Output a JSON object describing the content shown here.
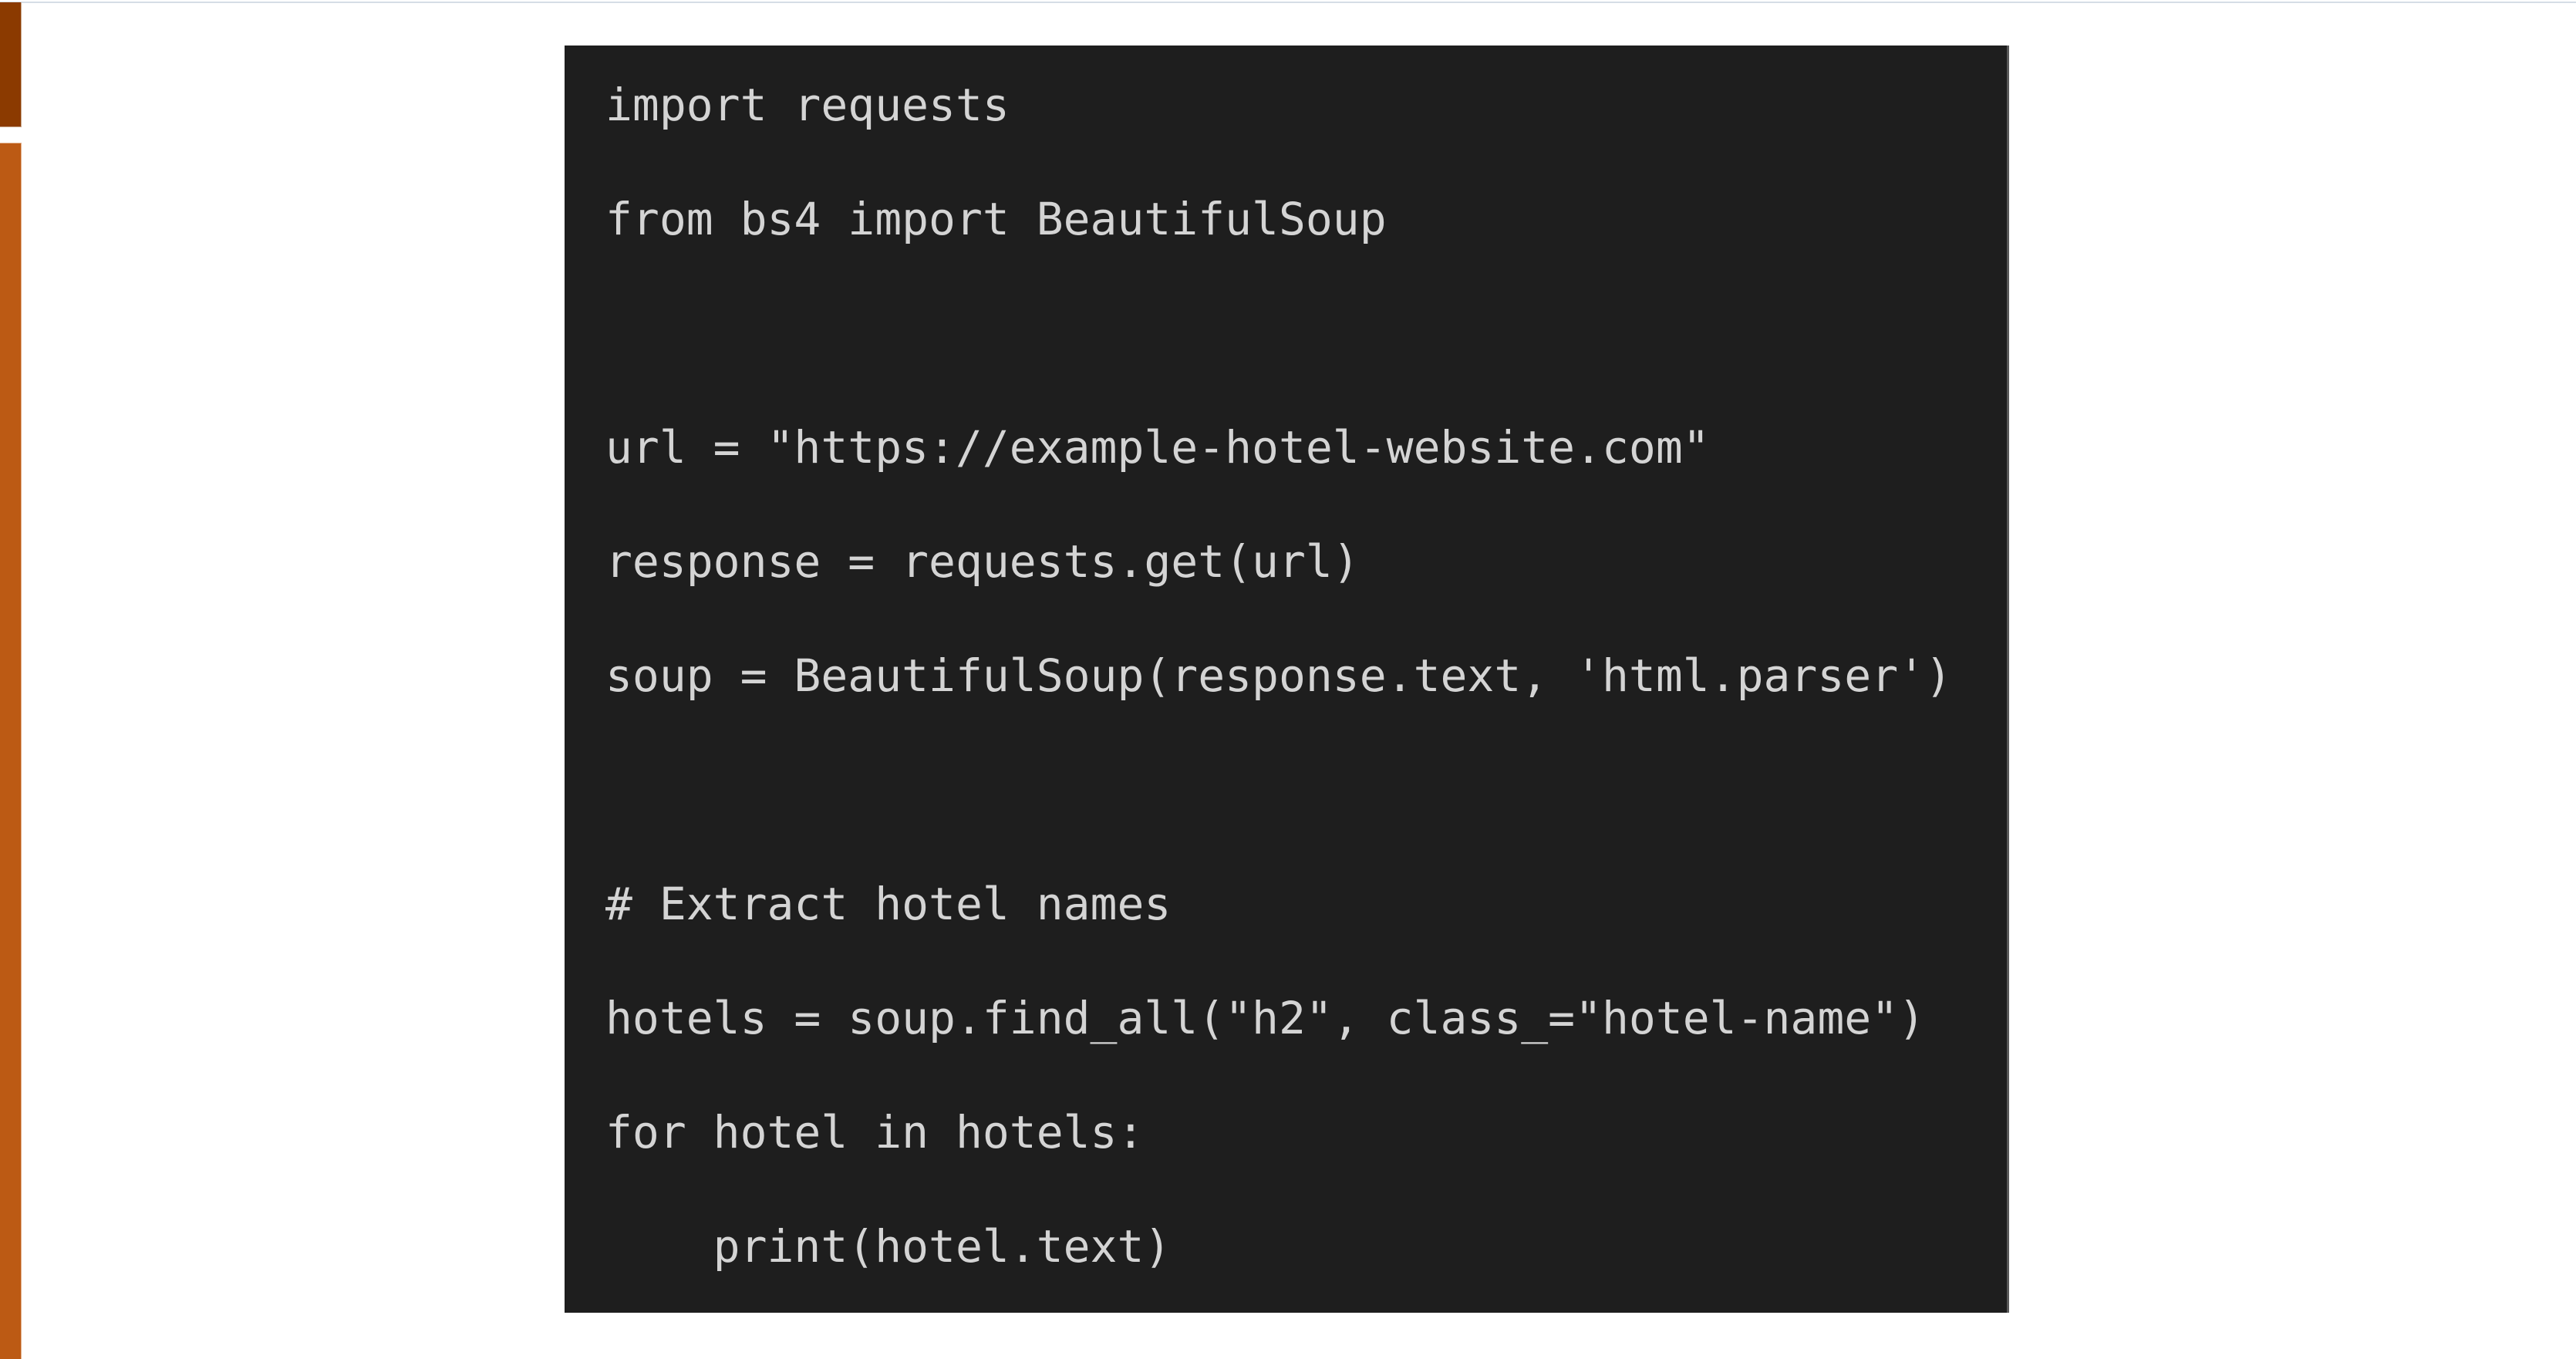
{
  "colors": {
    "accent_dark": "#8b3a00",
    "accent_orange": "#bc5a14",
    "code_background": "#1e1e1e",
    "code_text": "#d4d4d4",
    "page_background": "#ffffff"
  },
  "code_block": {
    "language": "python",
    "lines": [
      "import requests",
      "from bs4 import BeautifulSoup",
      "",
      "url = \"https://example-hotel-website.com\"",
      "response = requests.get(url)",
      "soup = BeautifulSoup(response.text, 'html.parser')",
      "",
      "# Extract hotel names",
      "hotels = soup.find_all(\"h2\", class_=\"hotel-name\")",
      "for hotel in hotels:",
      "    print(hotel.text)"
    ]
  }
}
